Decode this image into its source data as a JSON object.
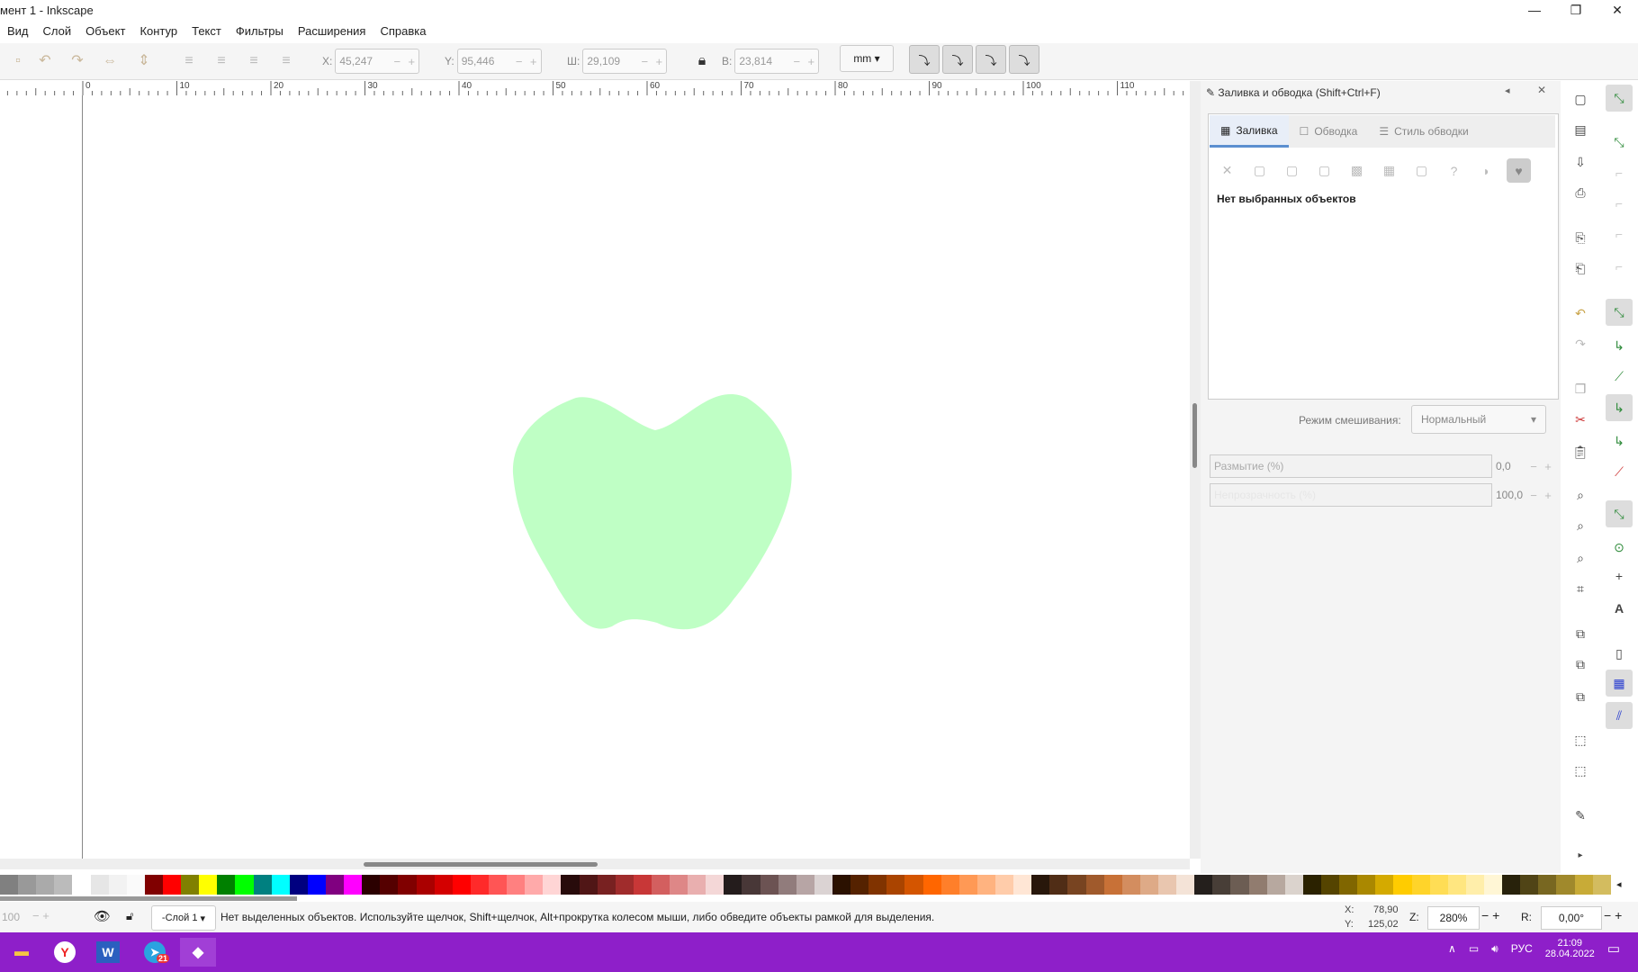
{
  "window": {
    "title": "мент 1 - Inkscape"
  },
  "menu": [
    "Вид",
    "Слой",
    "Объект",
    "Контур",
    "Текст",
    "Фильтры",
    "Расширения",
    "Справка"
  ],
  "toolbar": {
    "x_label": "X:",
    "x_value": "45,247",
    "y_label": "Y:",
    "y_value": "95,446",
    "w_label": "Ш:",
    "w_value": "29,109",
    "h_label": "В:",
    "h_value": "23,814",
    "unit": "mm"
  },
  "ruler_labels": [
    "0",
    "10",
    "20",
    "30",
    "40",
    "50",
    "60",
    "70",
    "80",
    "90",
    "100",
    "110"
  ],
  "canvas": {
    "shape_color": "#bfffc5"
  },
  "dock": {
    "title": "Заливка и обводка (Shift+Ctrl+F)",
    "tabs": [
      "Заливка",
      "Обводка",
      "Стиль обводки"
    ],
    "no_selection": "Нет выбранных объектов",
    "blend_label": "Режим смешивания:",
    "blend_value": "Нормальный",
    "blur_label": "Размытие (%)",
    "blur_value": "0,0",
    "opacity_label": "Непрозрачность (%)",
    "opacity_value": "100,0"
  },
  "palette": [
    "#808080",
    "#999",
    "#aaa",
    "#bbb",
    "#fff",
    "#e6e6e6",
    "#f2f2f2",
    "#fafafa",
    "#800000",
    "#ff0000",
    "#808000",
    "#ffff00",
    "#008000",
    "#00ff00",
    "#008080",
    "#00ffff",
    "#000080",
    "#0000ff",
    "#800080",
    "#ff00ff",
    "#2b0000",
    "#550000",
    "#800000",
    "#aa0000",
    "#d40000",
    "#ff0000",
    "#ff2a2a",
    "#ff5555",
    "#ff8080",
    "#ffaaaa",
    "#ffd5d5",
    "#280b0b",
    "#501616",
    "#782121",
    "#a02c2c",
    "#c83737",
    "#d35f5f",
    "#de8787",
    "#e9afaf",
    "#f4d7d7",
    "#241c1c",
    "#483737",
    "#6c5353",
    "#917c7c",
    "#b7a5a5",
    "#dbd3d3",
    "#2b1100",
    "#552200",
    "#803300",
    "#aa4400",
    "#d45500",
    "#ff6600",
    "#ff7f2a",
    "#ff9955",
    "#ffb380",
    "#ffccaa",
    "#ffe6d5",
    "#28170b",
    "#502d16",
    "#784421",
    "#a05a2c",
    "#c87137",
    "#d38d5f",
    "#deaa87",
    "#e9c6af",
    "#f4e3d7",
    "#241f1c",
    "#483e37",
    "#6c5d53",
    "#917c6f",
    "#b7a89f",
    "#dbd3cd",
    "#2b2200",
    "#554400",
    "#806600",
    "#aa8800",
    "#d4aa00",
    "#ffcc00",
    "#ffd42a",
    "#ffdd55",
    "#ffe680",
    "#ffeeaa",
    "#fff6d5",
    "#28220b",
    "#504416",
    "#786721",
    "#a0892c",
    "#c8ab37",
    "#d3bc5f"
  ],
  "status": {
    "zoom_left": "100",
    "layer": "-Слой 1",
    "message": "Нет выделенных объектов. Используйте щелчок, Shift+щелчок, Alt+прокрутка колесом мыши, либо обведите объекты рамкой для выделения.",
    "x_label": "X:",
    "x": "78,90",
    "y_label": "Y:",
    "y": "125,02",
    "z_label": "Z:",
    "zoom": "280%",
    "r_label": "R:",
    "rotation": "0,00°"
  },
  "taskbar": {
    "telegram_badge": "21",
    "lang": "РУС",
    "time": "21:09",
    "date": "28.04.2022"
  }
}
